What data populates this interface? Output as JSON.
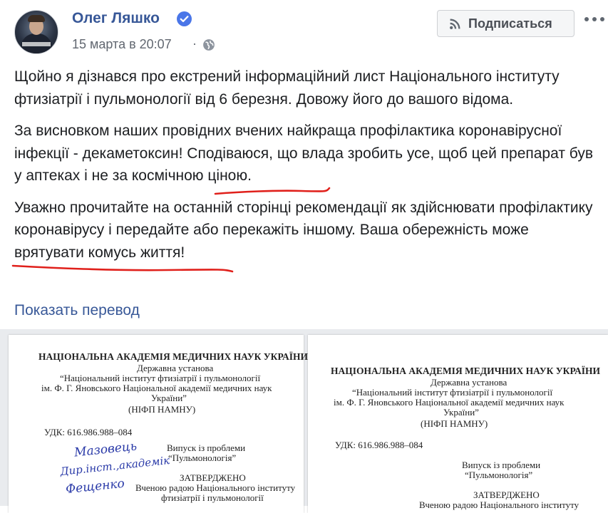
{
  "post": {
    "author": "Олег Ляшко",
    "timestamp": "15 марта в 20:07",
    "separator": "·",
    "subscribe_label": "Подписаться",
    "paragraphs": {
      "p1": "Щойно я дізнався про екстрений інформаційний лист Національного інституту фтизіатрії і пульмонології від 6 березня. Довожу його до вашого відома.",
      "p2_a": "За висновком наших провідних вчених найкраща профілактика коронавірусної інфекції - ",
      "p2_b": "декаметоксин",
      "p2_c": "! Сподіваюся, що влада зробить усе, щоб цей препарат був у аптеках і не за космічною ціною.",
      "p3_a": "Уважно прочитайте на останній сторінці рекомендації як здійснювати ",
      "p3_b": "профілактику коронавірусу",
      "p3_c": " і передайте або перекажіть іншому. Ваша обережність може врятувати комусь життя!"
    },
    "see_translation": "Показать перевод"
  },
  "colors": {
    "link": "#385898",
    "text": "#1c1e21",
    "meta": "#616770",
    "verified": "#4a76e8",
    "underline": "#e0201b",
    "signature_ink": "#2a3aa8"
  },
  "icons": {
    "verified": "verified-badge-icon",
    "privacy": "globe-icon",
    "subscribe": "rss-icon",
    "more": "more-dots-icon"
  },
  "document": {
    "academy": "НАЦІОНАЛЬНА АКАДЕМІЯ МЕДИЧНИХ НАУК УКРАЇНИ",
    "type": "Державна установа",
    "institute_1": "“Національний інститут фтизіатрії і пульмонології",
    "institute_2": "ім. Ф. Г. Яновського Національної академії медичних наук",
    "institute_3": "України”",
    "abbr": "(НІФП НАМНУ)",
    "udk": "УДК: 616.986.988–084",
    "issue_1": "Випуск із проблеми",
    "issue_2": "“Пульмонологія”",
    "approved": "ЗАТВЕРДЖЕНО",
    "council_1": "Вченою радою Національного інституту",
    "council_2": "фтизіатрії і пульмонології",
    "signature_1": "Мазовець",
    "signature_2": "Дир.інст.,академік",
    "signature_3": "Фещенко"
  }
}
